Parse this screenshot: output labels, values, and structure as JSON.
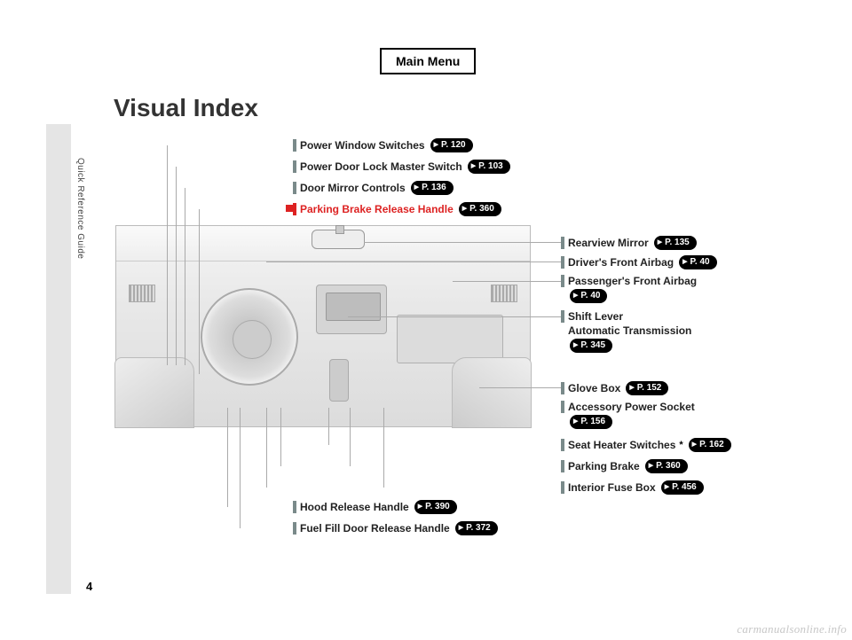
{
  "header": {
    "main_menu": "Main Menu"
  },
  "title": "Visual Index",
  "side_tab": "Quick Reference Guide",
  "page_number": "4",
  "watermark": "carmanualsonline.info",
  "callouts_top": [
    {
      "name": "power-window-switches",
      "label": "Power Window Switches",
      "page": "P. 120"
    },
    {
      "name": "power-door-lock-master-switch",
      "label": "Power Door Lock Master Switch",
      "page": "P. 103"
    },
    {
      "name": "door-mirror-controls",
      "label": "Door Mirror Controls",
      "page": "P. 136"
    },
    {
      "name": "parking-brake-release-handle",
      "label": "Parking Brake Release Handle",
      "page": "P. 360",
      "red": true
    }
  ],
  "callouts_right": [
    {
      "name": "rearview-mirror",
      "label": "Rearview Mirror",
      "page": "P. 135"
    },
    {
      "name": "drivers-front-airbag",
      "label": "Driver's Front Airbag",
      "page": "P. 40"
    },
    {
      "name": "passengers-front-airbag",
      "label": "Passenger's Front Airbag",
      "page": "P. 40",
      "wrap": true
    },
    {
      "name": "shift-lever",
      "label": "Shift Lever",
      "sub": "Automatic Transmission",
      "page": "P. 345",
      "wrap": true
    },
    {
      "name": "glove-box",
      "label": "Glove Box",
      "page": "P. 152"
    },
    {
      "name": "accessory-power-socket",
      "label": "Accessory Power Socket",
      "page": "P. 156",
      "wrap": true
    },
    {
      "name": "seat-heater-switches",
      "label": "Seat Heater Switches",
      "asterisk": "*",
      "page": "P. 162"
    },
    {
      "name": "parking-brake",
      "label": "Parking Brake",
      "page": "P. 360"
    },
    {
      "name": "interior-fuse-box",
      "label": "Interior Fuse Box",
      "page": "P. 456"
    }
  ],
  "callouts_bottom": [
    {
      "name": "hood-release-handle",
      "label": "Hood Release Handle",
      "page": "P. 390"
    },
    {
      "name": "fuel-fill-door-release-handle",
      "label": "Fuel Fill Door Release Handle",
      "page": "P. 372"
    }
  ]
}
